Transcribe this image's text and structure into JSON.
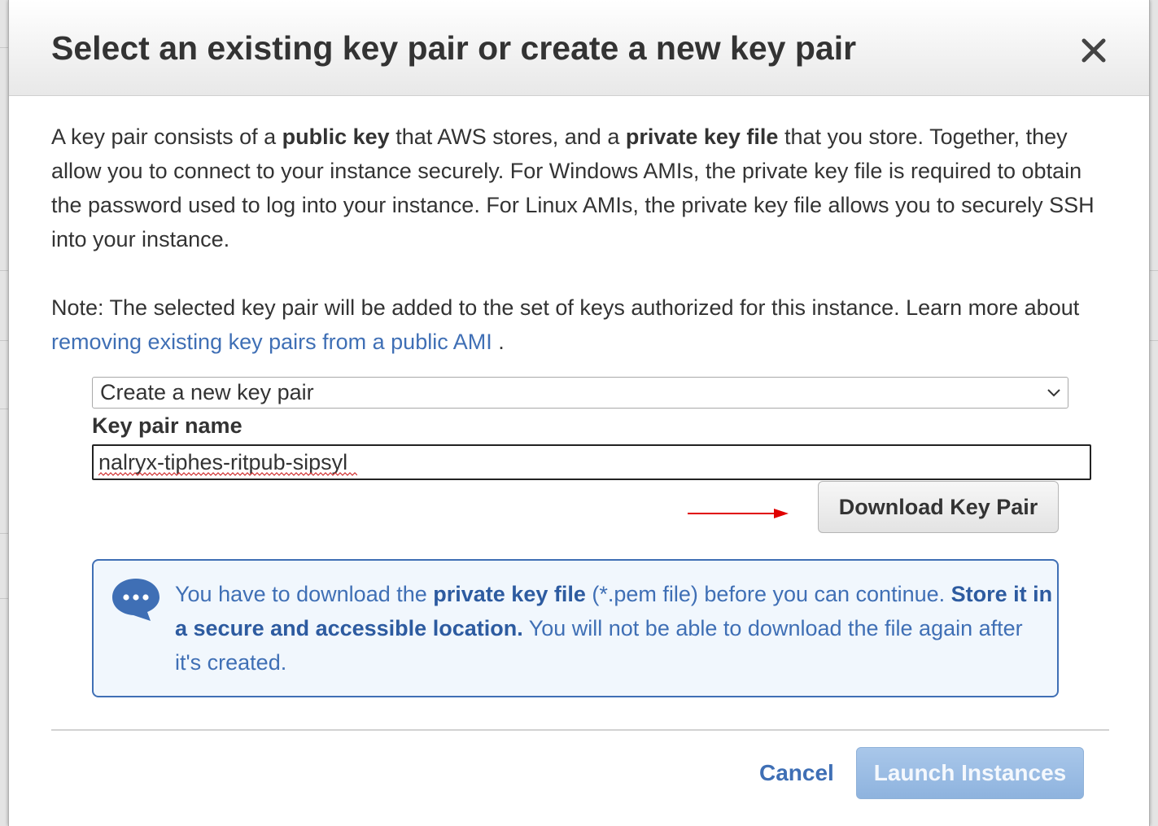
{
  "dialog": {
    "title": "Select an existing key pair or create a new key pair",
    "close_icon": "close-icon"
  },
  "intro": {
    "t1": "A key pair consists of a ",
    "b1": "public key",
    "t2": " that AWS stores, and a ",
    "b2": "private key file",
    "t3": " that you store. Together, they allow you to connect to your instance securely. For Windows AMIs, the private key file is required to obtain the password used to log into your instance. For Linux AMIs, the private key file allows you to securely SSH into your instance."
  },
  "note": {
    "t1": "Note: The selected key pair will be added to the set of keys authorized for this instance. Learn more about ",
    "link": "removing existing key pairs from a public AMI",
    "t2": " ."
  },
  "key_pair_select": {
    "selected": "Create a new key pair"
  },
  "key_pair_name": {
    "label": "Key pair name",
    "value": "nalryx-tiphes-ritpub-sipsyl"
  },
  "download_button": {
    "label": "Download Key Pair"
  },
  "info": {
    "t1": "You have to download the ",
    "b1": "private key file",
    "t2": " (*.pem file) before you can continue. ",
    "b2": "Store it in a secure and accessible location.",
    "t3": " You will not be able to download the file again after it's created.",
    "icon": "chat-bubble-icon"
  },
  "footer": {
    "cancel_label": "Cancel",
    "launch_label": "Launch Instances"
  },
  "colors": {
    "accent": "#3f6fb5",
    "info_bg": "#f1f7fd",
    "launch_disabled": "#9dbde4",
    "arrow": "#e00000"
  }
}
